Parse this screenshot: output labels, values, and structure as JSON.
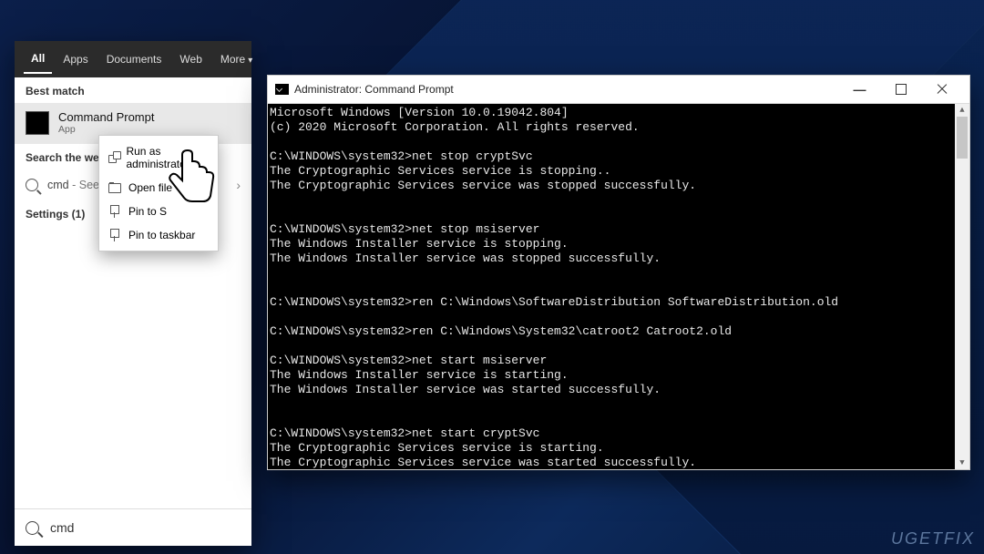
{
  "watermark": "UGETFIX",
  "search": {
    "tabs": {
      "all": "All",
      "apps": "Apps",
      "documents": "Documents",
      "web": "Web",
      "more": "More"
    },
    "best_match_header": "Best match",
    "best_match": {
      "title": "Command Prompt",
      "subtitle": "App"
    },
    "search_the_web_header": "Search the web",
    "web_result": {
      "query": "cmd",
      "suffix": "- See we"
    },
    "settings_header": "Settings (1)",
    "input_value": "cmd"
  },
  "context_menu": {
    "run_as_admin": "Run as administrator",
    "open_file_location": "Open file",
    "pin_to_start": "Pin to S",
    "pin_to_taskbar": "Pin to taskbar"
  },
  "cmd": {
    "title": "Administrator: Command Prompt",
    "lines": [
      "Microsoft Windows [Version 10.0.19042.804]",
      "(c) 2020 Microsoft Corporation. All rights reserved.",
      "",
      "C:\\WINDOWS\\system32>net stop cryptSvc",
      "The Cryptographic Services service is stopping..",
      "The Cryptographic Services service was stopped successfully.",
      "",
      "",
      "C:\\WINDOWS\\system32>net stop msiserver",
      "The Windows Installer service is stopping.",
      "The Windows Installer service was stopped successfully.",
      "",
      "",
      "C:\\WINDOWS\\system32>ren C:\\Windows\\SoftwareDistribution SoftwareDistribution.old",
      "",
      "C:\\WINDOWS\\system32>ren C:\\Windows\\System32\\catroot2 Catroot2.old",
      "",
      "C:\\WINDOWS\\system32>net start msiserver",
      "The Windows Installer service is starting.",
      "The Windows Installer service was started successfully.",
      "",
      "",
      "C:\\WINDOWS\\system32>net start cryptSvc",
      "The Cryptographic Services service is starting.",
      "The Cryptographic Services service was started successfully."
    ]
  }
}
